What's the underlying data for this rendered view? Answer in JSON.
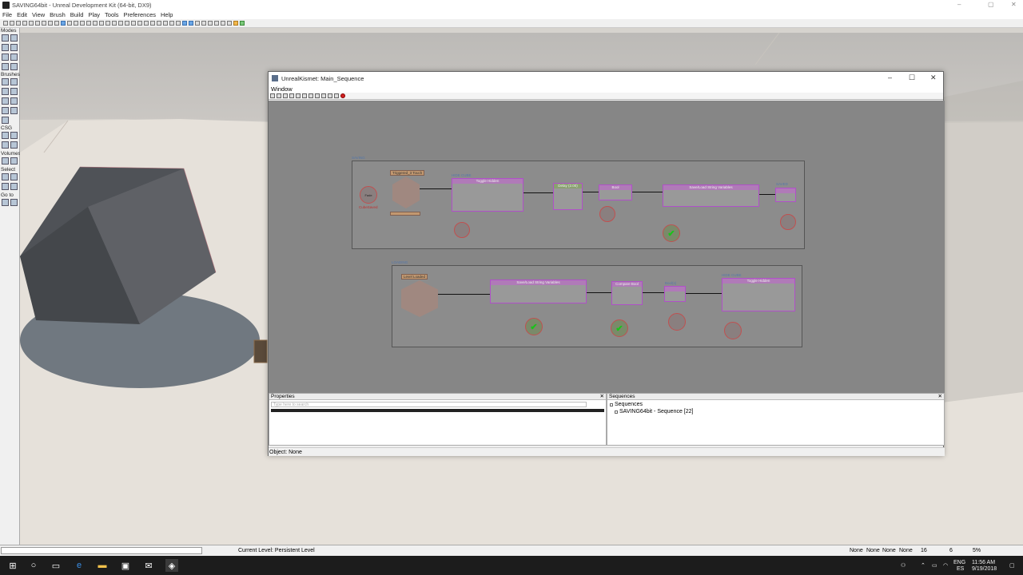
{
  "window": {
    "title": "SAVING64bit - Unreal Development Kit (64-bit, DX9)",
    "controls": [
      "–",
      "▢",
      "✕"
    ]
  },
  "menu": [
    "File",
    "Edit",
    "View",
    "Brush",
    "Build",
    "Play",
    "Tools",
    "Preferences",
    "Help"
  ],
  "modes_panel": {
    "labels": [
      "Modes",
      "Brushes",
      "CSG",
      "Volumes",
      "Select",
      "Go to"
    ]
  },
  "kismet": {
    "title": "UnrealKismet: Main_Sequence",
    "menu": [
      "Window"
    ],
    "controls": [
      "–",
      "☐",
      "✕"
    ],
    "sequences": [
      {
        "label": "SAVING"
      },
      {
        "label": "LOADING"
      }
    ],
    "nodes_saving": {
      "event": "Triggered_3 Touch",
      "var_fade": "Fade",
      "var_fade_label": "CubeSaved",
      "toggle_hidden_top": "HIDE CUBE",
      "toggle_hidden": "Toggle Hidden",
      "delay_top": "Delay (2.00)",
      "bool": "Bool",
      "saveload": "Save/Load String Variables",
      "saved_label": "SAVED",
      "check_label": "Trigger_1"
    },
    "nodes_loading": {
      "event": "Level Loaded",
      "saveload": "Save/Load String Variables",
      "compare": "Compare Bool",
      "bool_label": "Bool(s)",
      "toggle_hidden_top": "HIDE CUBE",
      "toggle_hidden": "Toggle Hidden"
    },
    "properties": {
      "title": "Properties",
      "search_placeholder": "Type here to search"
    },
    "sequences_panel": {
      "title": "Sequences",
      "root": "Sequences",
      "item": "SAVING64bit - Sequence [22]"
    },
    "status": "Object: None"
  },
  "statusbar": {
    "current_level_label": "Current Level:",
    "current_level_value": "Persistent Level",
    "right_values": [
      "None",
      "None",
      "None",
      "None",
      "16",
      "6",
      "5%"
    ]
  },
  "taskbar": {
    "lang": "ENG",
    "lang2": "ES",
    "time": "11:56 AM",
    "date": "9/19/2018"
  },
  "colors": {
    "kismet_canvas": "#868686",
    "node_border": "#b050c8",
    "check": "#19c419"
  }
}
